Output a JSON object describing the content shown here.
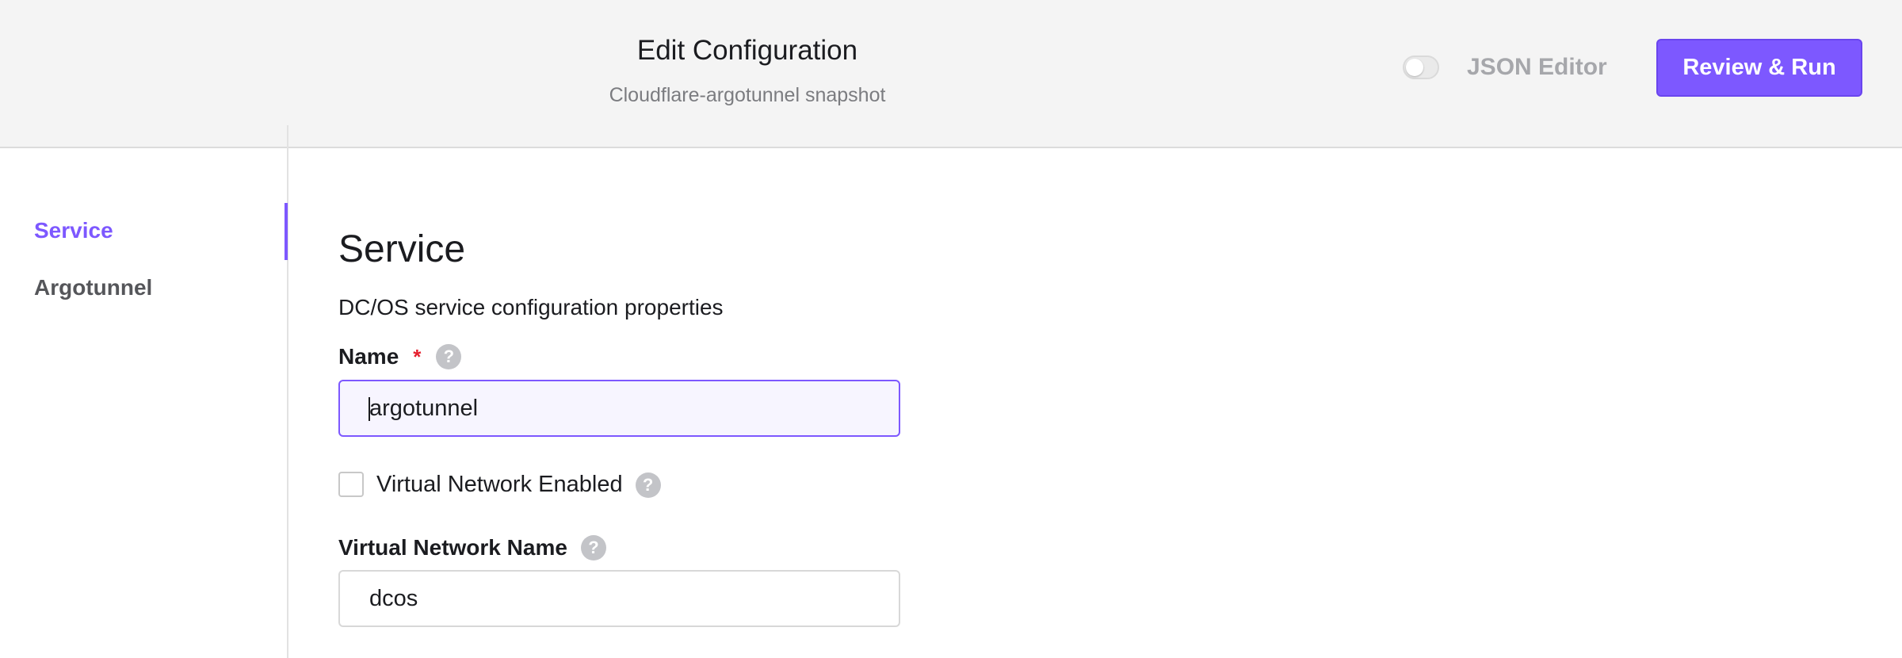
{
  "header": {
    "title": "Edit Configuration",
    "subtitle": "Cloudflare-argotunnel snapshot",
    "json_editor_label": "JSON Editor",
    "json_editor_enabled": false,
    "review_button_label": "Review & Run"
  },
  "sidebar": {
    "items": [
      {
        "label": "Service",
        "active": true
      },
      {
        "label": "Argotunnel",
        "active": false
      }
    ]
  },
  "main": {
    "section_title": "Service",
    "section_description": "DC/OS service configuration properties",
    "fields": {
      "name": {
        "label": "Name",
        "required_marker": "*",
        "value": "argotunnel"
      },
      "virtual_network_enabled": {
        "label": "Virtual Network Enabled",
        "checked": false
      },
      "virtual_network_name": {
        "label": "Virtual Network Name",
        "value": "dcos"
      }
    },
    "help_glyph": "?"
  },
  "colors": {
    "accent": "#7d58ff",
    "required": "#e5202e",
    "header_bg": "#f4f4f4",
    "help_icon": "#c3c4c8"
  }
}
